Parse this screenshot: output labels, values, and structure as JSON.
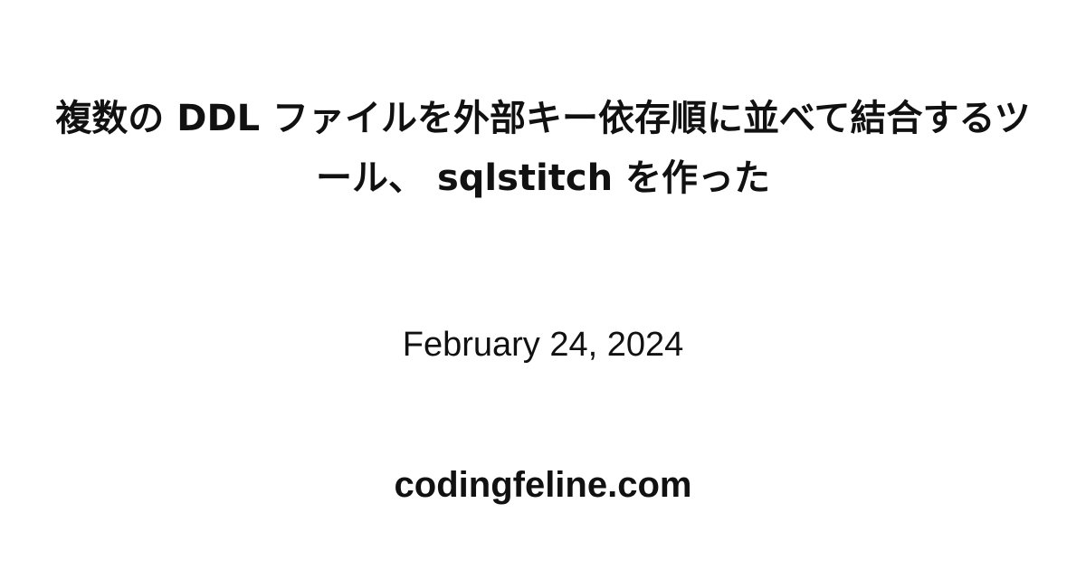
{
  "card": {
    "title": "複数の DDL ファイルを外部キー依存順に並べて結合するツール、 sqlstitch を作った",
    "date": "February 24, 2024",
    "site": "codingfeline.com",
    "colors": {
      "background": "#ffffff",
      "text": "#111111"
    }
  }
}
